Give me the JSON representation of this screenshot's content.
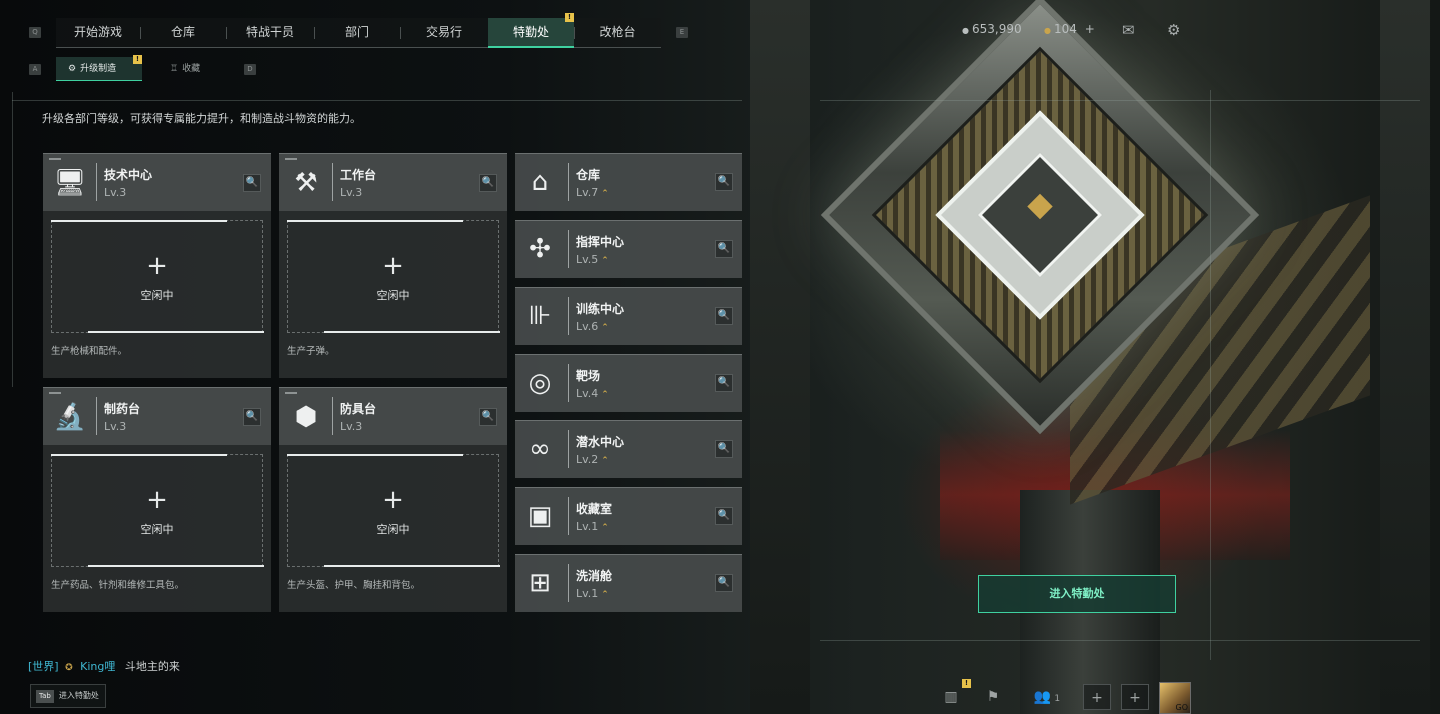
{
  "nav": {
    "key_left": "Q",
    "key_right": "E",
    "tabs": [
      {
        "label": "开始游戏",
        "active": false
      },
      {
        "label": "仓库",
        "active": false
      },
      {
        "label": "特战干员",
        "active": false
      },
      {
        "label": "部门",
        "active": false
      },
      {
        "label": "交易行",
        "active": false
      },
      {
        "label": "特勤处",
        "active": true
      },
      {
        "label": "改枪台",
        "active": false
      }
    ],
    "badge": "!"
  },
  "subnav": {
    "key_left": "A",
    "key_right": "D",
    "tabs": [
      {
        "label": "升级制造",
        "active": true
      },
      {
        "label": "收藏",
        "active": false
      }
    ],
    "badge": "!"
  },
  "currency": {
    "coins": "653,990",
    "tokens": "104",
    "tokens_plus": "+"
  },
  "description": "升级各部门等级，可获得专属能力提升，和制造战斗物资的能力。",
  "workshops": [
    {
      "name": "技术中心",
      "level": "Lv.3",
      "icon": "monitor-icon",
      "glyph": "🖥",
      "slot_plus": "+",
      "slot_status": "空闲中",
      "desc": "生产枪械和配件。"
    },
    {
      "name": "工作台",
      "level": "Lv.3",
      "icon": "tools-icon",
      "glyph": "⚒",
      "slot_plus": "+",
      "slot_status": "空闲中",
      "desc": "生产子弹。"
    },
    {
      "name": "制药台",
      "level": "Lv.3",
      "icon": "microscope-icon",
      "glyph": "🔬",
      "slot_plus": "+",
      "slot_status": "空闲中",
      "desc": "生产药品、针剂和维修工具包。"
    },
    {
      "name": "防具台",
      "level": "Lv.3",
      "icon": "armor-boxes-icon",
      "glyph": "⬢",
      "slot_plus": "+",
      "slot_status": "空闲中",
      "desc": "生产头盔、护甲、胸挂和背包。"
    }
  ],
  "facilities": [
    {
      "name": "仓库",
      "level": "Lv.7",
      "icon": "warehouse-icon",
      "glyph": "⌂"
    },
    {
      "name": "指挥中心",
      "level": "Lv.5",
      "icon": "command-chip-icon",
      "glyph": "✣"
    },
    {
      "name": "训练中心",
      "level": "Lv.6",
      "icon": "dumbbell-icon",
      "glyph": "⊪"
    },
    {
      "name": "靶场",
      "level": "Lv.4",
      "icon": "target-icon",
      "glyph": "◎"
    },
    {
      "name": "潜水中心",
      "level": "Lv.2",
      "icon": "diving-mask-icon",
      "glyph": "∞"
    },
    {
      "name": "收藏室",
      "level": "Lv.1",
      "icon": "collection-icon",
      "glyph": "▣"
    },
    {
      "name": "洗消舱",
      "level": "Lv.1",
      "icon": "decon-pod-icon",
      "glyph": "⊞"
    }
  ],
  "upgrade_glyph": "⌃",
  "search_glyph": "🔍",
  "enter_button": "进入特勤处",
  "chat": {
    "channel": "[世界]",
    "user": "King哩",
    "message": "斗地主的来"
  },
  "tab_hint": {
    "key": "Tab",
    "label": "进入特勤处"
  },
  "bottom_bar": {
    "friends_count": "1",
    "badge": "!",
    "avatar_text": "GO"
  },
  "colors": {
    "accent": "#3fd1a0",
    "badge": "#e7c24a",
    "upgrade_arrow": "#e2b84a",
    "chat_name": "#3fb7d1"
  }
}
